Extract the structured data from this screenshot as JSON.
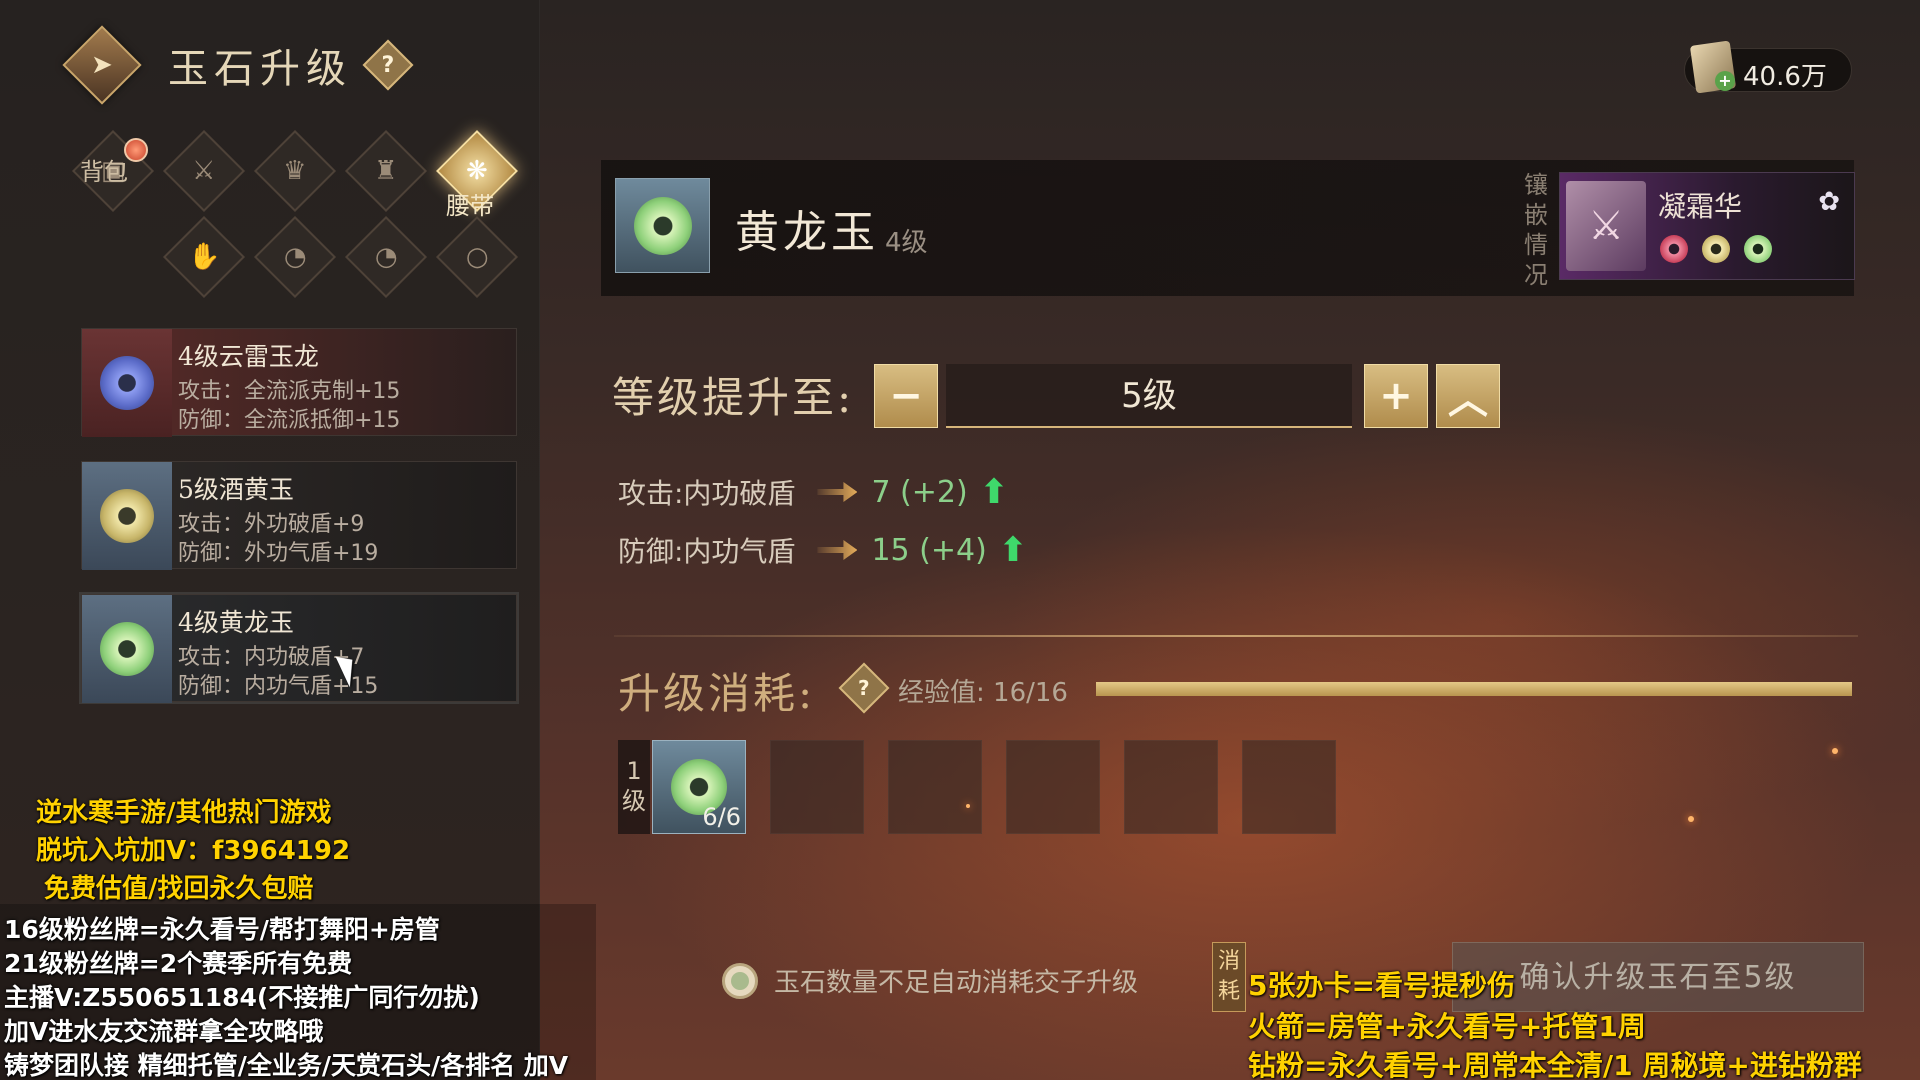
{
  "header": {
    "title": "玉石升级",
    "help_icon": "?",
    "currency_value": "40.6万"
  },
  "equipment_slots": [
    {
      "label": "背包",
      "icon": "bag-icon",
      "active": false
    },
    {
      "label": "",
      "icon": "sword-icon",
      "active": false
    },
    {
      "label": "",
      "icon": "helmet-icon",
      "active": false
    },
    {
      "label": "",
      "icon": "armor-icon",
      "active": false
    },
    {
      "label": "腰带",
      "icon": "belt-icon",
      "active": true
    },
    {
      "label": "",
      "icon": "glove-icon",
      "active": false
    },
    {
      "label": "",
      "icon": "ring-icon",
      "active": false
    },
    {
      "label": "",
      "icon": "ring-icon",
      "active": false
    },
    {
      "label": "",
      "icon": "necklace-icon",
      "active": false
    }
  ],
  "jade_list": [
    {
      "name": "4级云雷玉龙",
      "attack": "攻击：全流派克制+15",
      "defense": "防御：全流派抵御+15",
      "color": "#6f7fd6"
    },
    {
      "name": "5级酒黄玉",
      "attack": "攻击：外功破盾+9",
      "defense": "防御：外功气盾+19",
      "color": "#d8c77a"
    },
    {
      "name": "4级黄龙玉",
      "attack": "攻击：内功破盾+7",
      "defense": "防御：内功气盾+15",
      "color": "#9fd98a"
    }
  ],
  "selected_jade": {
    "name": "黄龙玉",
    "level": "4级",
    "inlay_label": "镶嵌情况",
    "inlay_item": "凝霜华",
    "inlay_gem_colors": [
      "#d8566a",
      "#d8c77a",
      "#9fd98a"
    ]
  },
  "upgrade": {
    "label": "等级提升至:",
    "target_level": "5级",
    "minus": "−",
    "plus": "+",
    "max": "︿",
    "stats": [
      {
        "name": "攻击:内功破盾",
        "value": "7 (+2)"
      },
      {
        "name": "防御:内功气盾",
        "value": "15 (+4)"
      }
    ]
  },
  "cost": {
    "label": "升级消耗:",
    "exp_label": "经验值: 16/16",
    "exp_progress": 1.0,
    "tier": "1级",
    "material_count": "6/6",
    "auto_consume": "玉石数量不足自动消耗交子升级",
    "consume_tag": "消耗",
    "confirm_button": "确认升级玉石至5级"
  },
  "overlay": {
    "yellow_left": [
      "逆水寒手游/其他热门游戏",
      "脱坑入坑加V：f3964192",
      "免费估值/找回永久包赔"
    ],
    "white_left": [
      "16级粉丝牌=永久看号/帮打舞阳+房管",
      "21级粉丝牌=2个赛季所有免费",
      "主播V:Z550651184(不接推广同行勿扰)",
      "加V进水友交流群拿全攻略哦",
      "铸梦团队接 精细托管/全业务/天赏石头/各排名 加V"
    ],
    "yellow_right": [
      "5张办卡=看号提秒伤",
      "火箭=房管+永久看号+托管1周",
      "钻粉=永久看号+周常本全清/1 周秘境+进钻粉群"
    ]
  }
}
